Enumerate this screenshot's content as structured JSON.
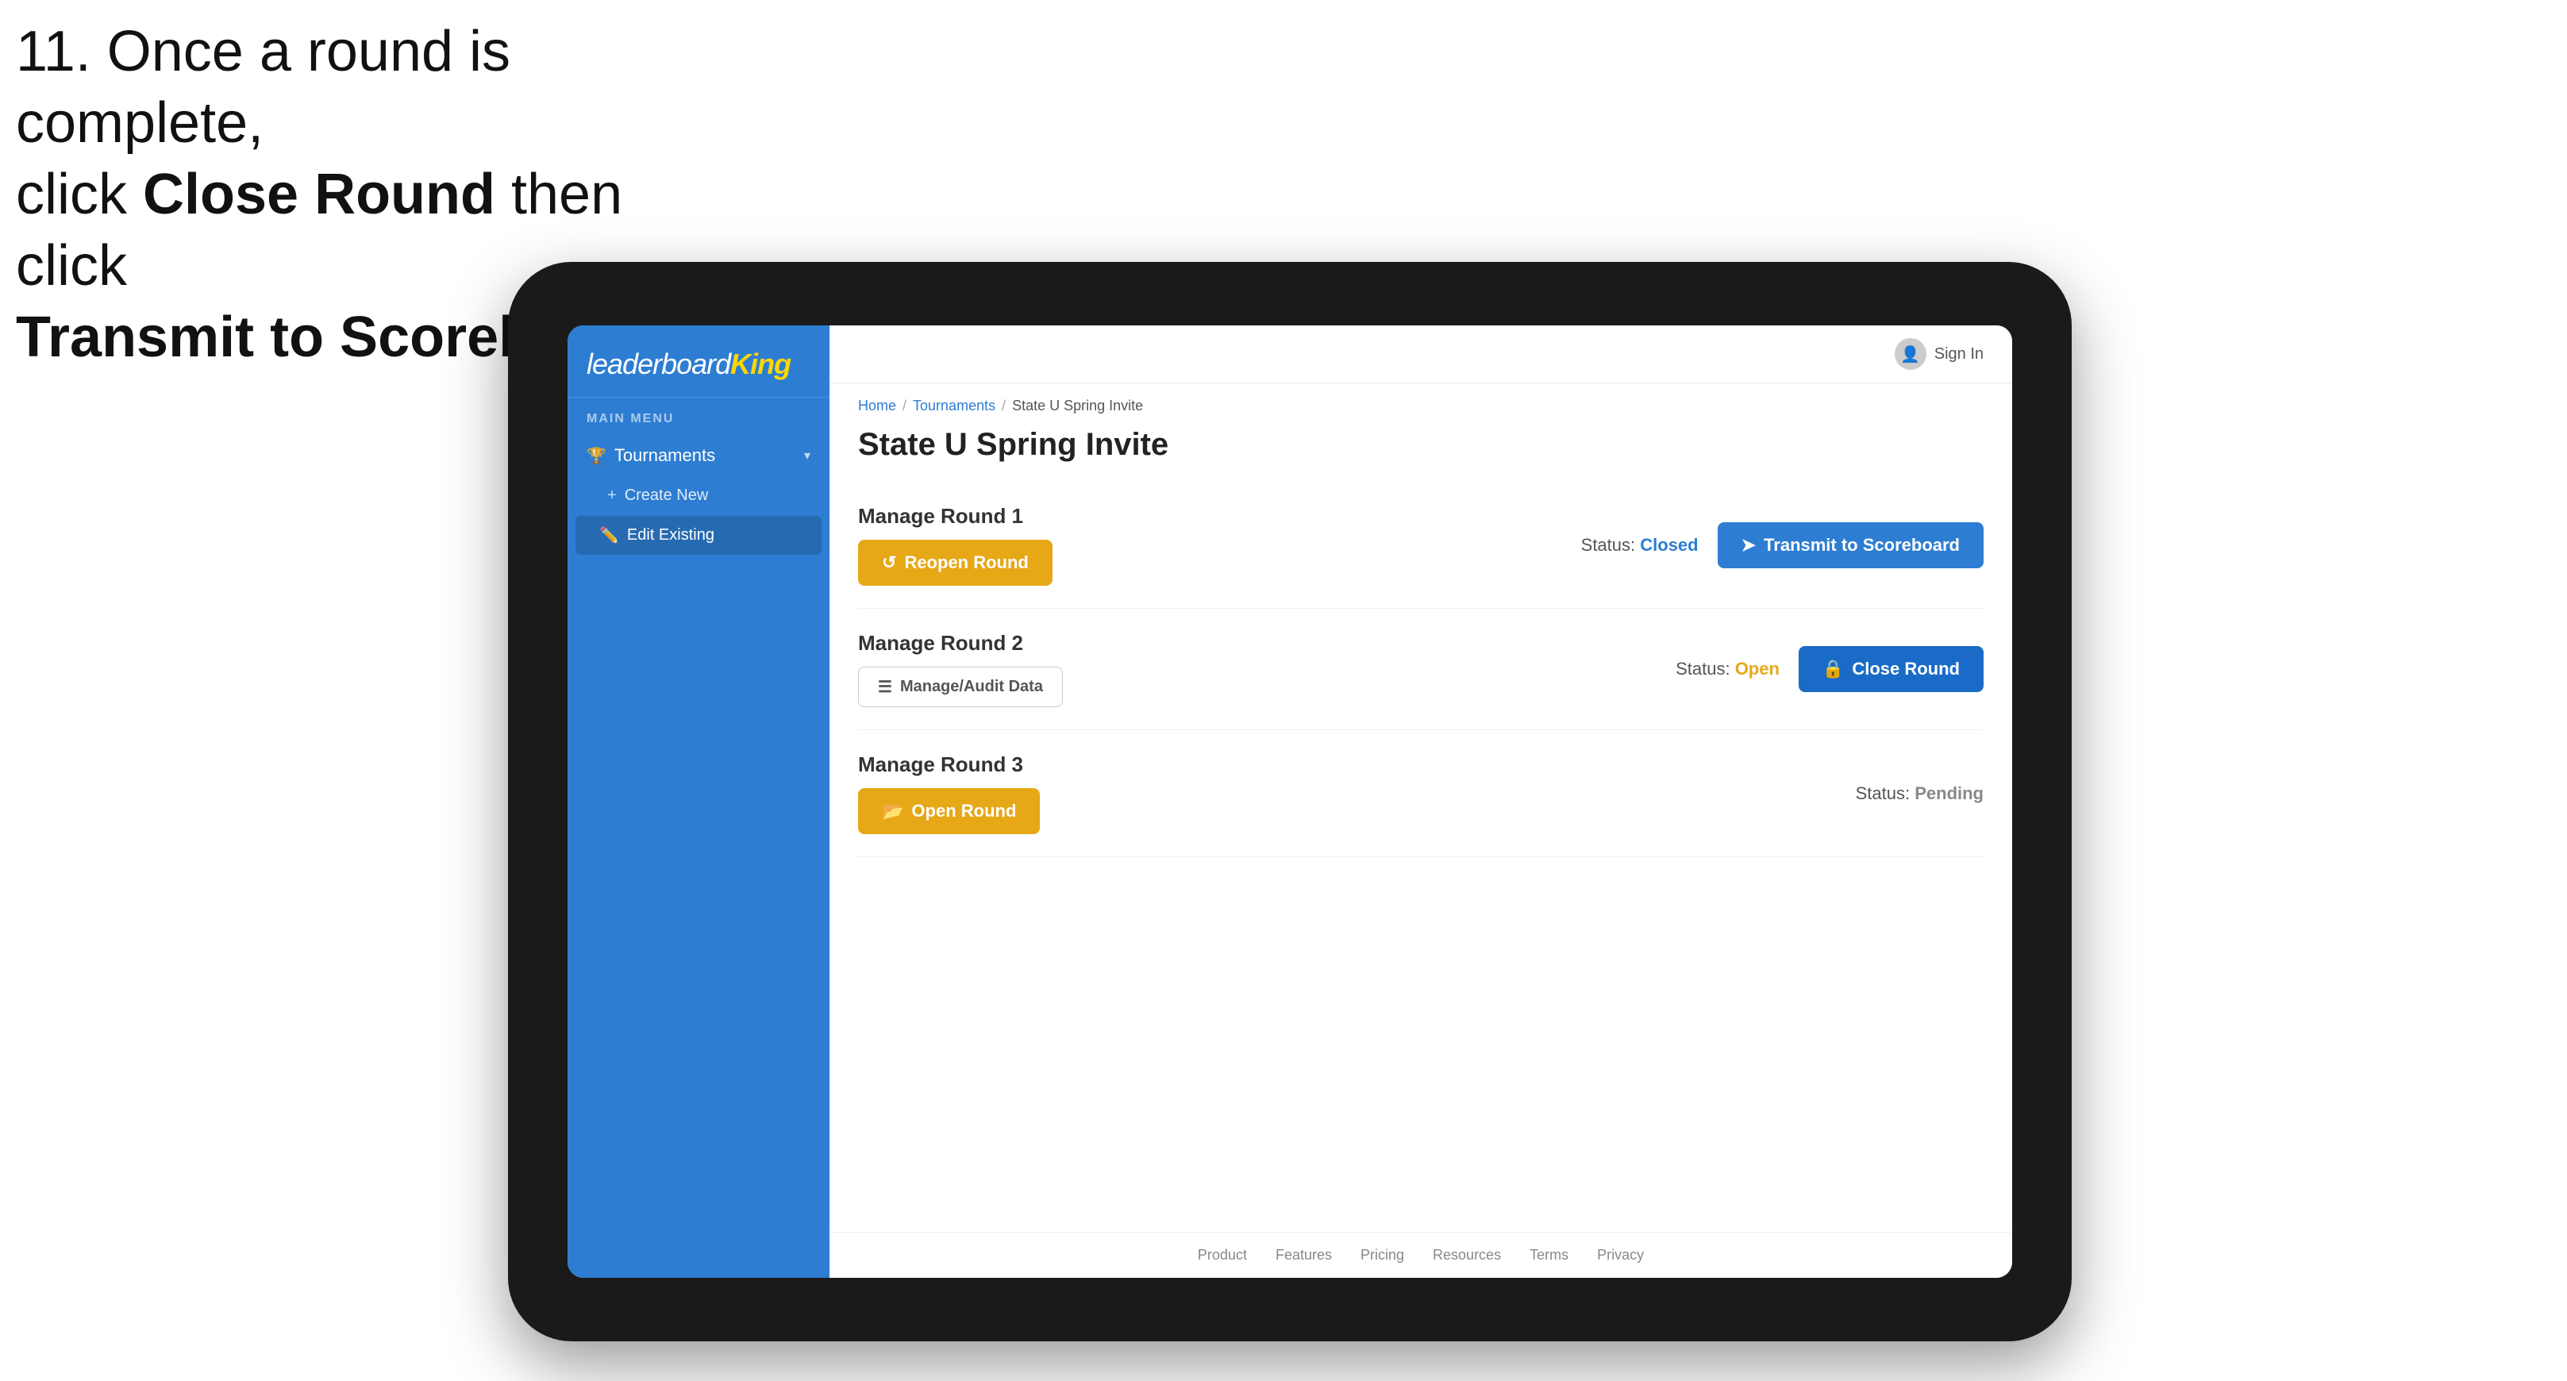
{
  "instruction": {
    "line1": "11. Once a round is complete,",
    "line2": "click ",
    "bold1": "Close Round",
    "line3": " then click",
    "bold2": "Transmit to Scoreboard."
  },
  "sidebar": {
    "logo": "leaderboard",
    "logo_strong": "King",
    "section_label": "MAIN MENU",
    "items": [
      {
        "label": "Tournaments",
        "icon": "🏆",
        "has_chevron": true
      },
      {
        "label": "Create New",
        "icon": "+",
        "is_sub": true
      },
      {
        "label": "Edit Existing",
        "icon": "✏️",
        "is_sub": true,
        "active": true
      }
    ]
  },
  "header": {
    "sign_in": "Sign In"
  },
  "breadcrumb": {
    "home": "Home",
    "sep1": "/",
    "tournaments": "Tournaments",
    "sep2": "/",
    "current": "State U Spring Invite"
  },
  "page_title": "State U Spring Invite",
  "rounds": [
    {
      "title": "Manage Round 1",
      "status_label": "Status:",
      "status_value": "Closed",
      "status_type": "closed",
      "button1": {
        "label": "Reopen Round",
        "type": "amber",
        "icon": "↺"
      },
      "button2": {
        "label": "Transmit to Scoreboard",
        "type": "blue",
        "icon": "➤"
      }
    },
    {
      "title": "Manage Round 2",
      "status_label": "Status:",
      "status_value": "Open",
      "status_type": "open",
      "button1": {
        "label": "Manage/Audit Data",
        "type": "outline-gray",
        "icon": "☰"
      },
      "button2": {
        "label": "Close Round",
        "type": "blue-dark",
        "icon": "🔒"
      }
    },
    {
      "title": "Manage Round 3",
      "status_label": "Status:",
      "status_value": "Pending",
      "status_type": "pending",
      "button1": {
        "label": "Open Round",
        "type": "amber",
        "icon": "📂"
      },
      "button2": null
    }
  ],
  "footer": {
    "links": [
      "Product",
      "Features",
      "Pricing",
      "Resources",
      "Terms",
      "Privacy"
    ]
  }
}
